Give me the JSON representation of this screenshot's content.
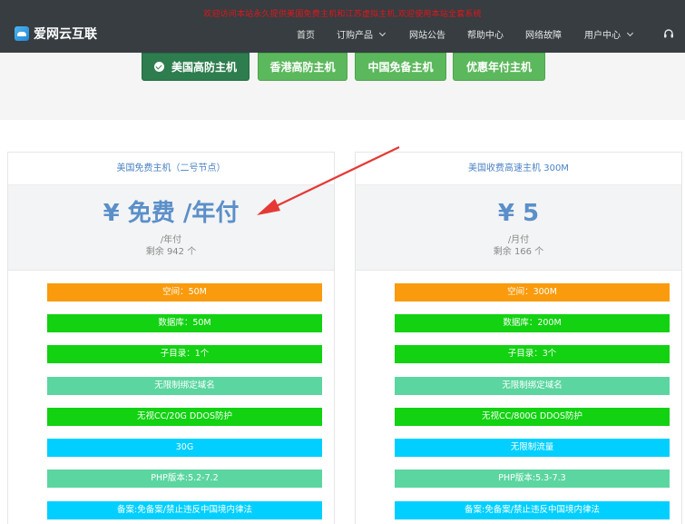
{
  "header": {
    "marquee": "欢迎访问本站永久提供美国免费主机和江苏虚拟主机,欢迎使用本站全套系统",
    "logo_text": "爱网云互联",
    "nav": [
      {
        "label": "首页",
        "dropdown": false
      },
      {
        "label": "订购产品",
        "dropdown": true
      },
      {
        "label": "网站公告",
        "dropdown": false
      },
      {
        "label": "帮助中心",
        "dropdown": false
      },
      {
        "label": "网络故障",
        "dropdown": false
      },
      {
        "label": "用户中心",
        "dropdown": true
      }
    ],
    "support_icon": "headset-icon"
  },
  "tabs": [
    {
      "label": "美国高防主机",
      "active": true
    },
    {
      "label": "香港高防主机",
      "active": false
    },
    {
      "label": "中国免备主机",
      "active": false
    },
    {
      "label": "优惠年付主机",
      "active": false
    }
  ],
  "plans": [
    {
      "title": "美国免费主机（二号节点）",
      "price": "¥ 免费 /年付",
      "period": "/年付",
      "remaining": "剩余 942 个",
      "features": [
        {
          "text": "空间：50M",
          "color": "#f99b0c"
        },
        {
          "text": "数据库：50M",
          "color": "#12d212"
        },
        {
          "text": "子目录：1个",
          "color": "#12d212"
        },
        {
          "text": "无限制绑定域名",
          "color": "#5bd6a0"
        },
        {
          "text": "无视CC/20G DDOS防护",
          "color": "#12d212"
        },
        {
          "text": "30G",
          "color": "#00cfff"
        },
        {
          "text": "PHP版本:5.2-7.2",
          "color": "#5bd6a0"
        },
        {
          "text": "备案:免备案/禁止违反中国境内律法",
          "color": "#00cfff"
        }
      ]
    },
    {
      "title": "美国收费高速主机 300M",
      "price": "¥ 5",
      "period": "/月付",
      "remaining": "剩余 166 个",
      "features": [
        {
          "text": "空间：300M",
          "color": "#f99b0c"
        },
        {
          "text": "数据库：200M",
          "color": "#12d212"
        },
        {
          "text": "子目录：3个",
          "color": "#12d212"
        },
        {
          "text": "无限制绑定域名",
          "color": "#5bd6a0"
        },
        {
          "text": "无视CC/800G DDOS防护",
          "color": "#12d212"
        },
        {
          "text": "无限制流量",
          "color": "#00cfff"
        },
        {
          "text": "PHP版本:5.3-7.3",
          "color": "#5bd6a0"
        },
        {
          "text": "备案:免备案/禁止违反中国境内律法",
          "color": "#00cfff"
        }
      ]
    }
  ],
  "annotation": {
    "color": "#e53935"
  }
}
